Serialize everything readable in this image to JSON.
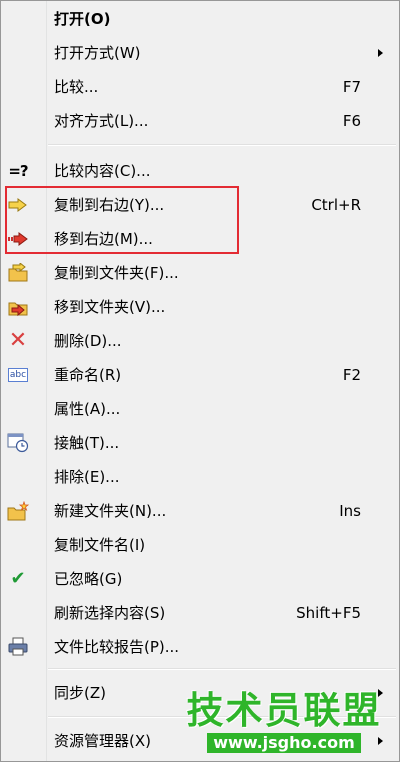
{
  "menu": {
    "items": [
      {
        "label": "打开(O)",
        "shortcut": "",
        "icon": "",
        "submenu": false,
        "bold": true
      },
      {
        "label": "打开方式(W)",
        "shortcut": "",
        "icon": "",
        "submenu": true
      },
      {
        "label": "比较...",
        "shortcut": "F7",
        "icon": "",
        "submenu": false
      },
      {
        "label": "对齐方式(L)...",
        "shortcut": "F6",
        "icon": "",
        "submenu": false
      },
      {
        "label": "比较内容(C)...",
        "shortcut": "",
        "icon": "compare-content-icon",
        "icon_text": "=?",
        "submenu": false
      },
      {
        "label": "复制到右边(Y)...",
        "shortcut": "Ctrl+R",
        "icon": "copy-right-arrow-icon",
        "submenu": false
      },
      {
        "label": "移到右边(M)...",
        "shortcut": "",
        "icon": "move-right-arrow-icon",
        "submenu": false
      },
      {
        "label": "复制到文件夹(F)...",
        "shortcut": "",
        "icon": "copy-to-folder-icon",
        "submenu": false
      },
      {
        "label": "移到文件夹(V)...",
        "shortcut": "",
        "icon": "move-to-folder-icon",
        "submenu": false
      },
      {
        "label": "删除(D)...",
        "shortcut": "",
        "icon": "delete-icon",
        "icon_text": "✕",
        "submenu": false
      },
      {
        "label": "重命名(R)",
        "shortcut": "F2",
        "icon": "rename-icon",
        "icon_text": "abc",
        "submenu": false
      },
      {
        "label": "属性(A)...",
        "shortcut": "",
        "icon": "",
        "submenu": false
      },
      {
        "label": "接触(T)...",
        "shortcut": "",
        "icon": "touch-clock-icon",
        "submenu": false
      },
      {
        "label": "排除(E)...",
        "shortcut": "",
        "icon": "",
        "submenu": false
      },
      {
        "label": "新建文件夹(N)...",
        "shortcut": "Ins",
        "icon": "new-folder-icon",
        "submenu": false
      },
      {
        "label": "复制文件名(I)",
        "shortcut": "",
        "icon": "",
        "submenu": false
      },
      {
        "label": "已忽略(G)",
        "shortcut": "",
        "icon": "check-icon",
        "icon_text": "✔",
        "submenu": false
      },
      {
        "label": "刷新选择内容(S)",
        "shortcut": "Shift+F5",
        "icon": "",
        "submenu": false
      },
      {
        "label": "文件比较报告(P)...",
        "shortcut": "",
        "icon": "printer-icon",
        "submenu": false
      },
      {
        "label": "同步(Z)",
        "shortcut": "",
        "icon": "",
        "submenu": true
      },
      {
        "label": "资源管理器(X)",
        "shortcut": "",
        "icon": "",
        "submenu": true
      }
    ]
  },
  "watermark": {
    "title": "技术员联盟",
    "url": "www.jsgho.com"
  },
  "colors": {
    "menu_bg": "#f0f0f0",
    "highlight_border": "#e32b33",
    "watermark_green": "#2fb52a"
  }
}
